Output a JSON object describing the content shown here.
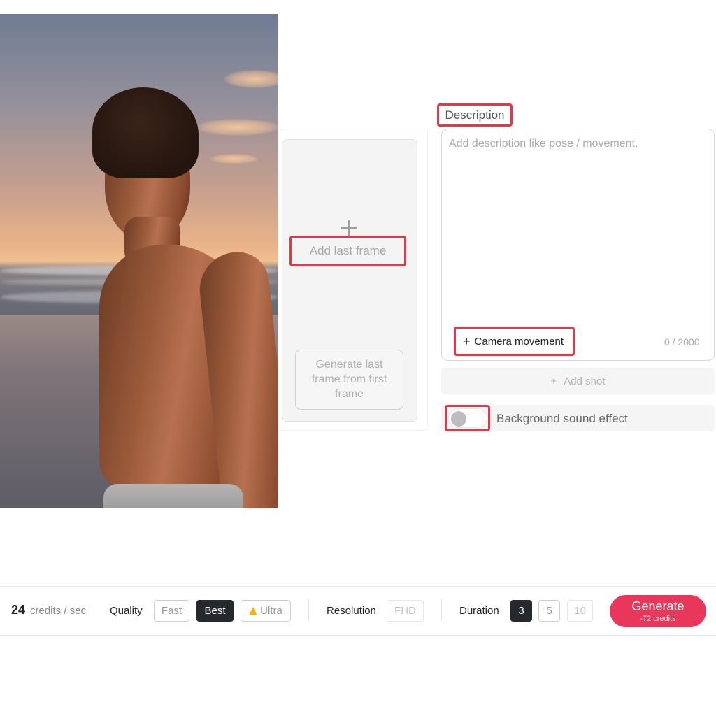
{
  "last_frame": {
    "add_label": "Add last frame",
    "generate_label": "Generate last frame from first frame"
  },
  "description": {
    "label": "Description",
    "placeholder": "Add description like pose / movement.",
    "camera_movement_label": "Camera movement",
    "char_count": "0 / 2000"
  },
  "add_shot_label": "Add shot",
  "background_sound": {
    "label": "Background sound effect",
    "enabled": false
  },
  "toolbar": {
    "credits_value": "24",
    "credits_unit": "credits / sec",
    "quality_label": "Quality",
    "quality_options": [
      "Fast",
      "Best",
      "Ultra"
    ],
    "quality_selected": "Best",
    "resolution_label": "Resolution",
    "resolution_value": "FHD",
    "duration_label": "Duration",
    "duration_options": [
      "3",
      "5",
      "10"
    ],
    "duration_selected": "3",
    "generate_label": "Generate",
    "generate_cost": "-72 credits"
  },
  "colors": {
    "highlight_border": "#e03a48",
    "generate_button": "#e8375a",
    "active_chip": "#25282d",
    "ultra_icon": "#f0b21a"
  }
}
